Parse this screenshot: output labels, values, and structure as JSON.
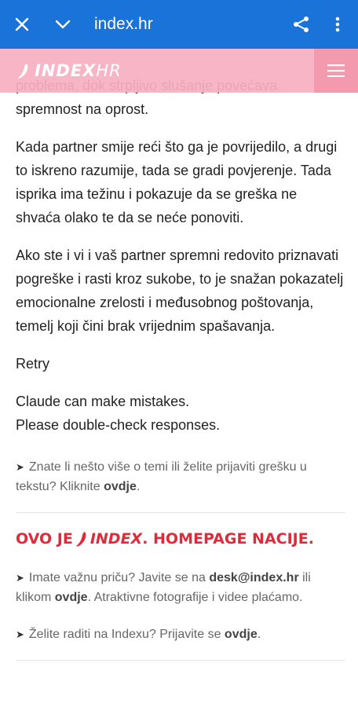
{
  "browser": {
    "url": "index.hr",
    "close_icon": "close-icon",
    "collapse_icon": "chevron-down-icon",
    "share_icon": "share-icon",
    "menu_icon": "more-vertical-icon"
  },
  "site": {
    "logo_text": "INDEX",
    "logo_suffix": "HR",
    "menu_icon": "hamburger-icon",
    "brand_color": "#e02a3a",
    "header_color": "#f7afc1"
  },
  "article": {
    "paragraphs": [
      "problema, dok strpljivo slušanje povećava spremnost na oprost.",
      "Kada partner smije reći što ga je povrijedilo, a drugi to iskreno razumije, tada se gradi povjerenje. Tada isprika ima težinu i pokazuje da se greška ne shvaća olako te da se neće ponoviti.",
      "Ako ste i vi i vaš partner spremni redovito priznavati pogreške i rasti kroz sukobe, to je snažan pokazatelj emocionalne zrelosti i međusobnog poštovanja, temelj koji čini brak vrijednim spašavanja.",
      "Retry",
      "Claude can make mistakes.",
      "Please double-check responses."
    ]
  },
  "report": {
    "text": "Znate li nešto više o temi ili želite prijaviti grešku u tekstu? Kliknite ",
    "link": "ovdje",
    "end": "."
  },
  "slogan": {
    "part1": "OVO JE ",
    "brand": "INDEX",
    "part2": ". HOMEPAGE NACIJE."
  },
  "contact": {
    "text1": "Imate važnu priču? Javite se na ",
    "email": "desk@index.hr",
    "text2": " ili klikom ",
    "link": "ovdje",
    "text3": ". Atraktivne fotografije i videe plaćamo."
  },
  "jobs": {
    "text": "Želite raditi na Indexu? Prijavite se ",
    "link": "ovdje",
    "end": "."
  }
}
